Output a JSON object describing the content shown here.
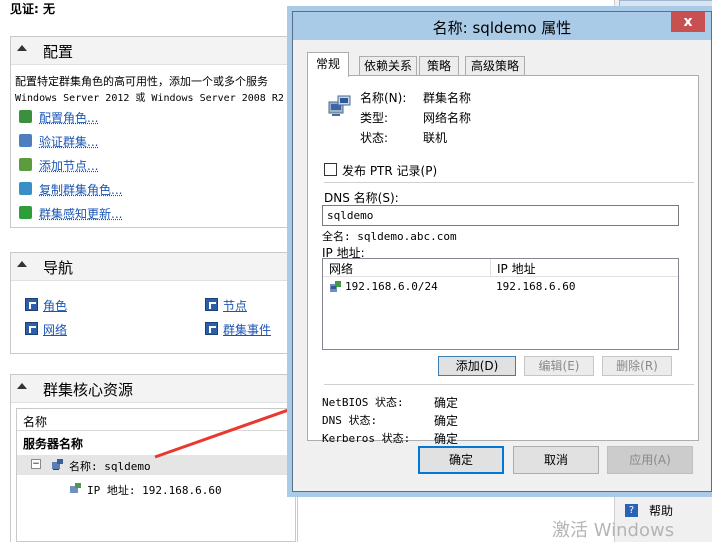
{
  "background": {
    "witness": "见证: 无",
    "config": {
      "title": "配置",
      "desc1": "配置特定群集角色的高可用性，添加一个或多个服务",
      "desc2": "Windows Server 2012 或 Windows Server 2008 R2",
      "actions": [
        "配置角色...",
        "验证群集...",
        "添加节点...",
        "复制群集角色...",
        "群集感知更新..."
      ]
    },
    "nav": {
      "title": "导航",
      "links": [
        "角色",
        "节点",
        "网络",
        "群集事件"
      ]
    },
    "resources": {
      "title": "群集核心资源",
      "column": "名称",
      "group": "服务器名称",
      "item": "名称: sqldemo",
      "sub": "IP 地址: 192.168.6.60"
    },
    "help": "帮助",
    "watermark": "激活 Windows"
  },
  "dialog": {
    "title": "名称: sqldemo 属性",
    "close": "x",
    "tabs": [
      "常规",
      "依赖关系",
      "策略",
      "高级策略"
    ],
    "name_label": "名称(N):",
    "name_value": "群集名称",
    "type_label": "类型:",
    "type_value": "网络名称",
    "status_label": "状态:",
    "status_value": "联机",
    "publish_ptr": "发布 PTR 记录(P)",
    "dns_label": "DNS 名称(S):",
    "dns_value": "sqldemo",
    "fqdn": "全名: sqldemo.abc.com",
    "ip_label": "IP 地址:",
    "ip_columns": [
      "网络",
      "IP 地址"
    ],
    "ip_rows": [
      {
        "network": "192.168.6.0/24",
        "ip": "192.168.6.60"
      }
    ],
    "buttons": {
      "add": "添加(D)",
      "edit": "编辑(E)",
      "remove": "删除(R)"
    },
    "netbios_label": "NetBIOS 状态:",
    "netbios_value": "确定",
    "dns_status_label": "DNS 状态:",
    "dns_status_value": "确定",
    "kerberos_label": "Kerberos 状态:",
    "kerberos_value": "确定",
    "ok": "确定",
    "cancel": "取消",
    "apply": "应用(A)"
  },
  "colors": {
    "annotation_arrow": "#e8392f",
    "link": "#1a55b5",
    "titlebar": "#aacbe8"
  }
}
